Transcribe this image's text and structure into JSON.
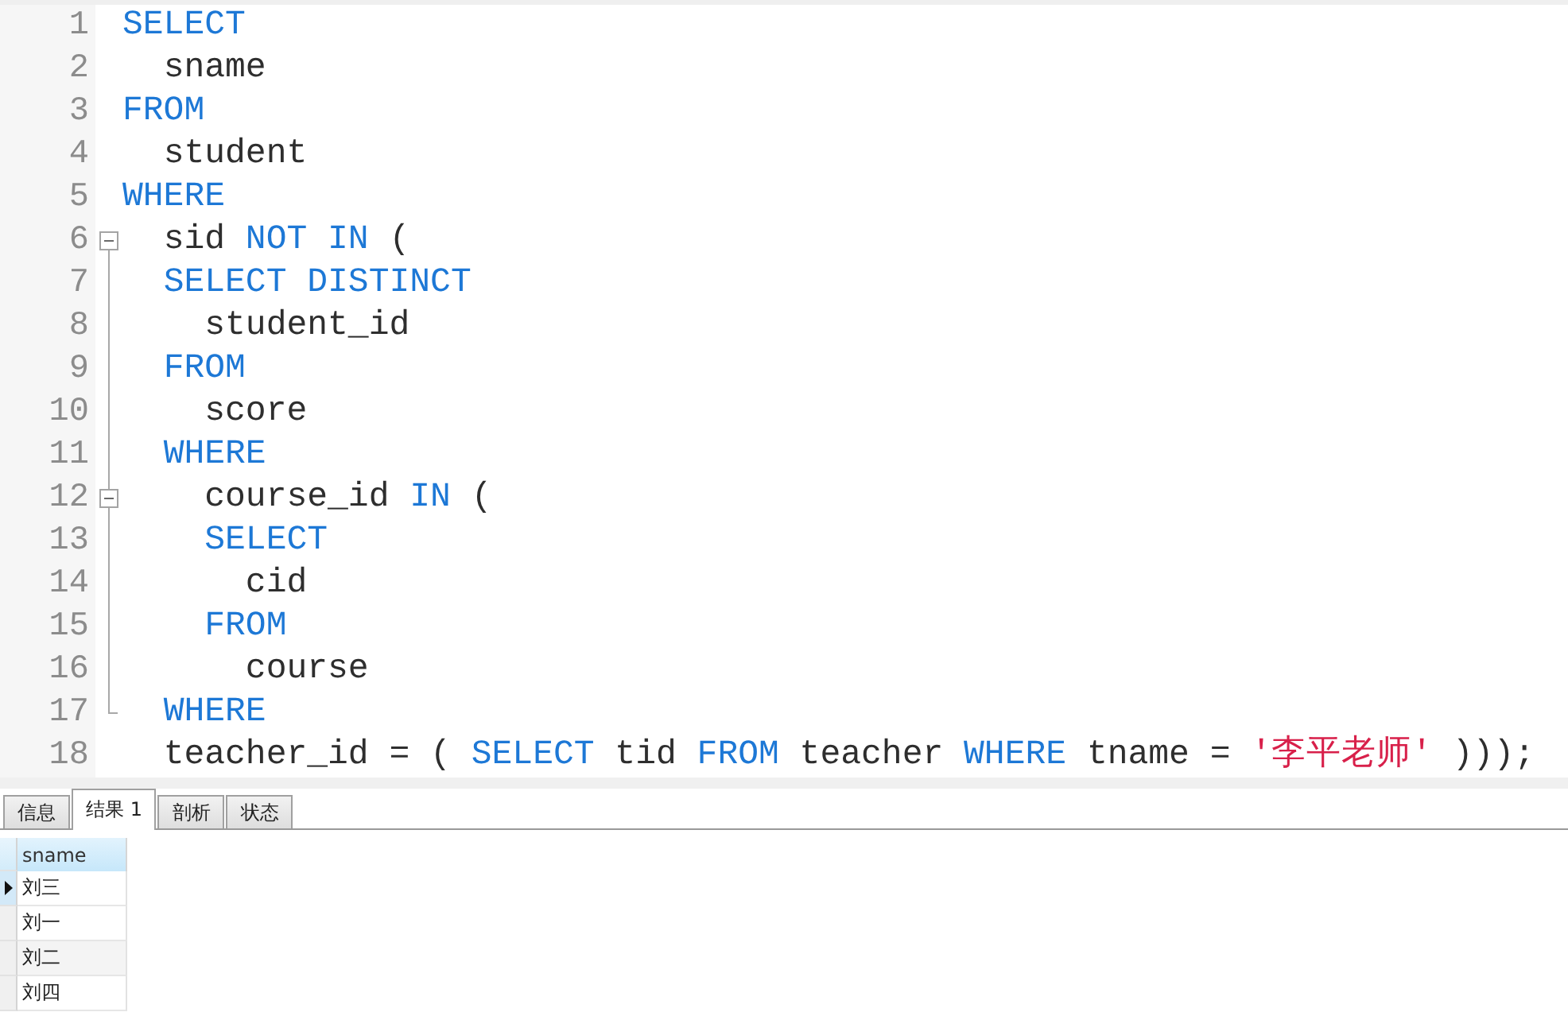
{
  "editor": {
    "lines": [
      {
        "number": "1",
        "tokens": [
          {
            "text": "SELECT",
            "kind": "keyword"
          }
        ]
      },
      {
        "number": "2",
        "tokens": [
          {
            "text": "  sname",
            "kind": "plain"
          }
        ]
      },
      {
        "number": "3",
        "tokens": [
          {
            "text": "FROM",
            "kind": "keyword"
          }
        ]
      },
      {
        "number": "4",
        "tokens": [
          {
            "text": "  student",
            "kind": "plain"
          }
        ]
      },
      {
        "number": "5",
        "tokens": [
          {
            "text": "WHERE",
            "kind": "keyword"
          }
        ]
      },
      {
        "number": "6",
        "fold": {
          "kind": "start",
          "expanded": true
        },
        "tokens": [
          {
            "text": "  sid ",
            "kind": "plain"
          },
          {
            "text": "NOT IN",
            "kind": "keyword"
          },
          {
            "text": " (",
            "kind": "plain"
          }
        ]
      },
      {
        "number": "7",
        "fold": {
          "kind": "guide"
        },
        "tokens": [
          {
            "text": "  SELECT DISTINCT",
            "kind": "keyword"
          }
        ]
      },
      {
        "number": "8",
        "fold": {
          "kind": "guide"
        },
        "tokens": [
          {
            "text": "    student_id",
            "kind": "plain"
          }
        ]
      },
      {
        "number": "9",
        "fold": {
          "kind": "guide"
        },
        "tokens": [
          {
            "text": "  FROM",
            "kind": "keyword"
          }
        ]
      },
      {
        "number": "10",
        "fold": {
          "kind": "guide"
        },
        "tokens": [
          {
            "text": "    score",
            "kind": "plain"
          }
        ]
      },
      {
        "number": "11",
        "fold": {
          "kind": "guide"
        },
        "tokens": [
          {
            "text": "  WHERE",
            "kind": "keyword"
          }
        ]
      },
      {
        "number": "12",
        "fold": {
          "kind": "inner_start",
          "expanded": true
        },
        "tokens": [
          {
            "text": "    course_id ",
            "kind": "plain"
          },
          {
            "text": "IN",
            "kind": "keyword"
          },
          {
            "text": " (",
            "kind": "plain"
          }
        ]
      },
      {
        "number": "13",
        "fold": {
          "kind": "guide"
        },
        "tokens": [
          {
            "text": "    SELECT",
            "kind": "keyword"
          }
        ]
      },
      {
        "number": "14",
        "fold": {
          "kind": "guide"
        },
        "tokens": [
          {
            "text": "      cid",
            "kind": "plain"
          }
        ]
      },
      {
        "number": "15",
        "fold": {
          "kind": "guide"
        },
        "tokens": [
          {
            "text": "    FROM",
            "kind": "keyword"
          }
        ]
      },
      {
        "number": "16",
        "fold": {
          "kind": "guide"
        },
        "tokens": [
          {
            "text": "      course",
            "kind": "plain"
          }
        ]
      },
      {
        "number": "17",
        "fold": {
          "kind": "end"
        },
        "tokens": [
          {
            "text": "  WHERE",
            "kind": "keyword"
          }
        ]
      },
      {
        "number": "18",
        "tokens": [
          {
            "text": "  teacher_id = ( ",
            "kind": "plain"
          },
          {
            "text": "SELECT",
            "kind": "keyword"
          },
          {
            "text": " tid ",
            "kind": "plain"
          },
          {
            "text": "FROM",
            "kind": "keyword"
          },
          {
            "text": " teacher ",
            "kind": "plain"
          },
          {
            "text": "WHERE",
            "kind": "keyword"
          },
          {
            "text": " tname = ",
            "kind": "plain"
          },
          {
            "text": "'李平老师'",
            "kind": "string"
          },
          {
            "text": " )));",
            "kind": "plain"
          }
        ]
      }
    ]
  },
  "results": {
    "tabs": [
      {
        "label": "信息",
        "selected": false
      },
      {
        "label": "结果 1",
        "selected": true
      },
      {
        "label": "剖析",
        "selected": false
      },
      {
        "label": "状态",
        "selected": false
      }
    ],
    "columns": [
      "sname"
    ],
    "rows": [
      {
        "cells": [
          "刘三"
        ],
        "selected": true
      },
      {
        "cells": [
          "刘一"
        ],
        "selected": false
      },
      {
        "cells": [
          "刘二"
        ],
        "selected": false
      },
      {
        "cells": [
          "刘四"
        ],
        "selected": false
      }
    ]
  }
}
